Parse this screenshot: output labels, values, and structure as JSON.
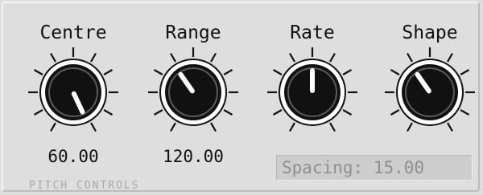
{
  "section_label": "PITCH CONTROLS",
  "knobs": [
    {
      "label": "Centre",
      "value": "60.00",
      "pointer_deg": -25
    },
    {
      "label": "Range",
      "value": "120.00",
      "pointer_deg": 145
    },
    {
      "label": "Rate",
      "value": "",
      "pointer_deg": 180
    },
    {
      "label": "Shape",
      "value": "",
      "pointer_deg": 145
    }
  ],
  "spacing": {
    "label": "Spacing:",
    "value": "15.00"
  },
  "colors": {
    "panel": "#dedede",
    "knob_face": "#111111",
    "knob_ring": "#ffffff",
    "pointer": "#ffffff",
    "text": "#111111",
    "display_text": "#8f8f8f"
  }
}
